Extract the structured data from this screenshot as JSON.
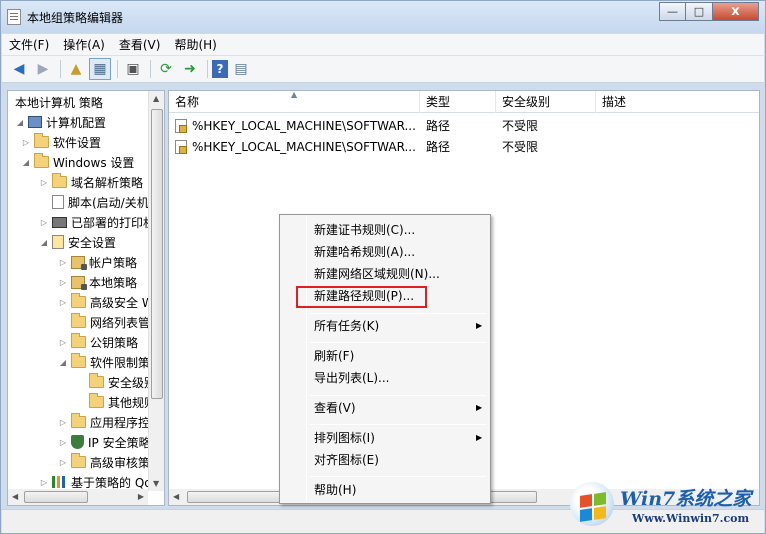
{
  "window": {
    "title": "本地组策略编辑器",
    "controls": {
      "minimize": "—",
      "maximize": "□",
      "close": "x"
    }
  },
  "menubar": [
    "文件(F)",
    "操作(A)",
    "查看(V)",
    "帮助(H)"
  ],
  "toolbar": {
    "icons": [
      "back-icon",
      "forward-icon",
      "up-folder-icon",
      "show-hide-tree-icon",
      "properties-icon",
      "refresh-icon",
      "export-list-icon",
      "help-icon",
      "view-icon"
    ]
  },
  "tree": {
    "items": [
      {
        "label": "本地计算机 策略",
        "icon": "none"
      },
      {
        "label": "计算机配置",
        "icon": "computer-icon"
      },
      {
        "label": "软件设置",
        "icon": "folder-icon"
      },
      {
        "label": "Windows 设置",
        "icon": "folder-icon"
      },
      {
        "label": "域名解析策略",
        "icon": "folder-icon"
      },
      {
        "label": "脚本(启动/关机)",
        "icon": "script-icon"
      },
      {
        "label": "已部署的打印机",
        "icon": "printer-icon"
      },
      {
        "label": "安全设置",
        "icon": "security-settings-icon"
      },
      {
        "label": "帐户策略",
        "icon": "lock-folder-icon"
      },
      {
        "label": "本地策略",
        "icon": "lock-folder-icon"
      },
      {
        "label": "高级安全 Windows 防火墙",
        "icon": "folder-icon"
      },
      {
        "label": "网络列表管理器策略",
        "icon": "folder-icon"
      },
      {
        "label": "公钥策略",
        "icon": "folder-icon"
      },
      {
        "label": "软件限制策略",
        "icon": "folder-icon"
      },
      {
        "label": "安全级别",
        "icon": "folder-icon"
      },
      {
        "label": "其他规则",
        "icon": "folder-icon"
      },
      {
        "label": "应用程序控制策略",
        "icon": "folder-icon"
      },
      {
        "label": "IP 安全策略",
        "icon": "ip-security-icon"
      },
      {
        "label": "高级审核策略配置",
        "icon": "folder-icon"
      },
      {
        "label": "基于策略的 QoS",
        "icon": "qos-chart-icon"
      }
    ]
  },
  "list": {
    "columns": [
      "名称",
      "类型",
      "安全级别",
      "描述"
    ],
    "rows": [
      {
        "name": "%HKEY_LOCAL_MACHINE\\SOFTWAR...",
        "type": "路径",
        "level": "不受限",
        "desc": ""
      },
      {
        "name": "%HKEY_LOCAL_MACHINE\\SOFTWAR...",
        "type": "路径",
        "level": "不受限",
        "desc": ""
      }
    ]
  },
  "context_menu": {
    "items": [
      {
        "label": "新建证书规则(C)...",
        "submenu": false
      },
      {
        "label": "新建哈希规则(A)...",
        "submenu": false
      },
      {
        "label": "新建网络区域规则(N)...",
        "submenu": false
      },
      {
        "label": "新建路径规则(P)...",
        "submenu": false,
        "highlighted": true
      },
      {
        "label": "所有任务(K)",
        "submenu": true
      },
      {
        "label": "刷新(F)",
        "submenu": false
      },
      {
        "label": "导出列表(L)...",
        "submenu": false
      },
      {
        "label": "查看(V)",
        "submenu": true
      },
      {
        "label": "排列图标(I)",
        "submenu": true
      },
      {
        "label": "对齐图标(E)",
        "submenu": false
      },
      {
        "label": "帮助(H)",
        "submenu": false
      }
    ]
  },
  "watermark": {
    "title": "Win7系统之家",
    "url": "Www.Winwin7.com"
  },
  "colors": {
    "highlight_border": "#e02020",
    "titlebar": "#c5d8ee",
    "watermark_text": "#1b5fae"
  }
}
